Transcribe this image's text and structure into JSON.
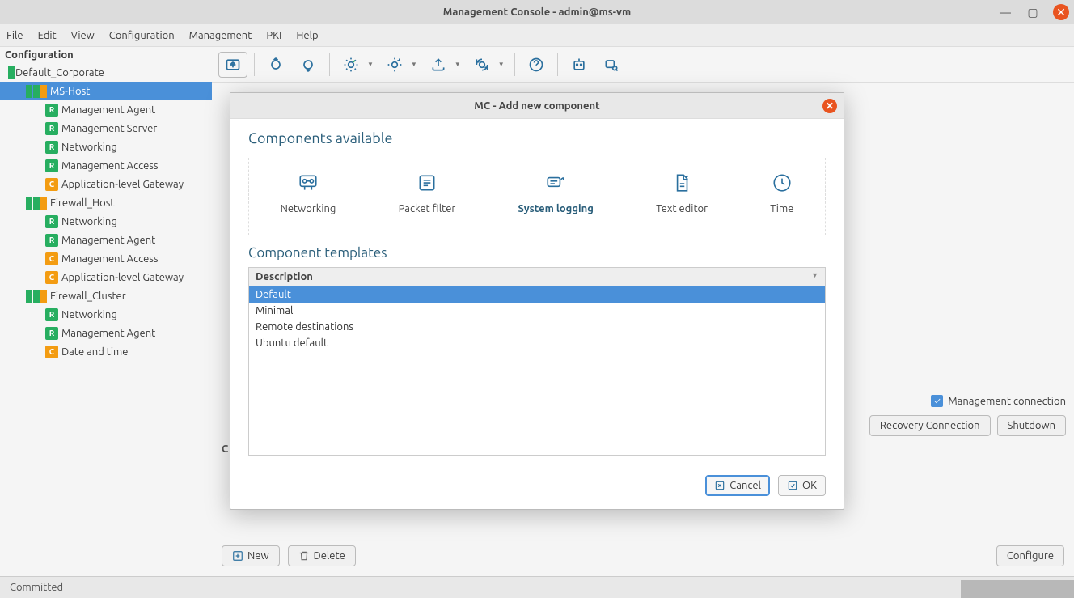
{
  "window": {
    "title": "Management Console - admin@ms-vm"
  },
  "menubar": {
    "file": "File",
    "edit": "Edit",
    "view": "View",
    "configuration": "Configuration",
    "management": "Management",
    "pki": "PKI",
    "help": "Help"
  },
  "sidebar": {
    "title": "Configuration",
    "site": "Default_Corporate",
    "host1": "MS-Host",
    "h1_0": "Management Agent",
    "h1_1": "Management Server",
    "h1_2": "Networking",
    "h1_3": "Management Access",
    "h1_4": "Application-level Gateway",
    "fw": "Firewall_Host",
    "fw_0": "Networking",
    "fw_1": "Management Agent",
    "fw_2": "Management Access",
    "fw_3": "Application-level Gateway",
    "fc": "Firewall_Cluster",
    "fc_0": "Networking",
    "fc_1": "Management Agent",
    "fc_2": "Date and time"
  },
  "right": {
    "mgmt_conn": "Management connection",
    "recovery": "Recovery Connection",
    "shutdown": "Shutdown",
    "new": "New",
    "delete": "Delete",
    "configure": "Configure",
    "c_label": "C"
  },
  "status": {
    "text": "Committed"
  },
  "dialog": {
    "title": "MC - Add new component",
    "h1": "Components available",
    "h2": "Component templates",
    "comp_networking": "Networking",
    "comp_packetfilter": "Packet filter",
    "comp_syslog": "System logging",
    "comp_texteditor": "Text editor",
    "comp_time": "Time",
    "col_desc": "Description",
    "t_default": "Default",
    "t_minimal": "Minimal",
    "t_remote": "Remote destinations",
    "t_ubuntu": "Ubuntu default",
    "cancel": "Cancel",
    "ok": "OK"
  }
}
